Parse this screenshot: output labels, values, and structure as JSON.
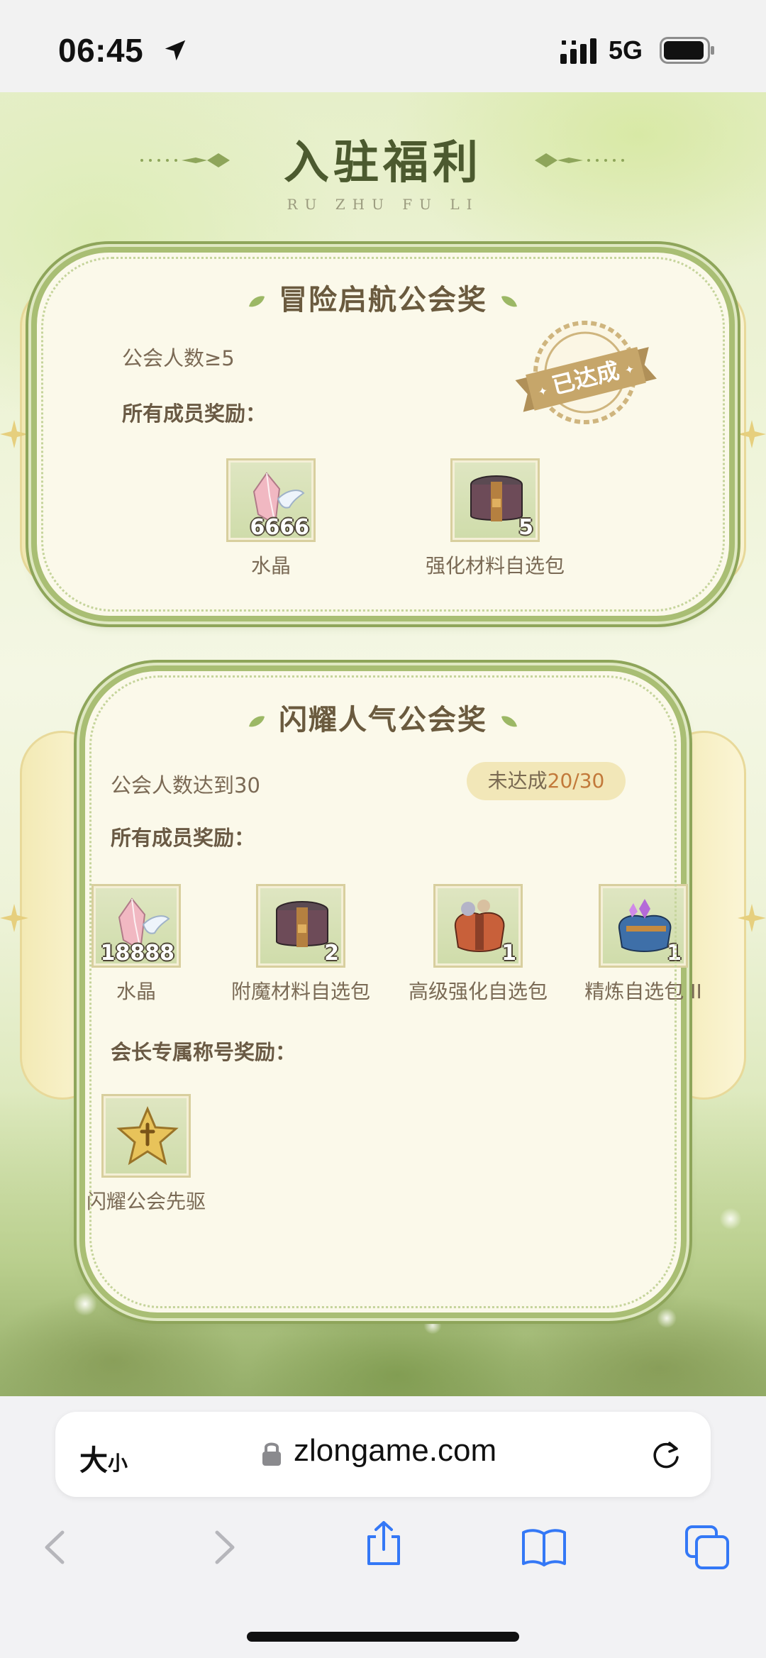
{
  "status_bar": {
    "time": "06:45",
    "network": "5G",
    "icons": [
      "location-arrow-icon",
      "signal-bars-icon",
      "battery-icon"
    ]
  },
  "page": {
    "title": "入驻福利",
    "subtitle": "RU ZHU FU LI"
  },
  "card1": {
    "title": "冒险启航公会奖",
    "condition": "公会人数≥5",
    "status": "已达成",
    "rewards_label": "所有成员奖励：",
    "rewards": [
      {
        "name": "水晶",
        "count": "6666",
        "icon": "crystal-icon"
      },
      {
        "name": "强化材料自选包",
        "count": "5",
        "icon": "material-chest-icon"
      }
    ]
  },
  "card2": {
    "title": "闪耀人气公会奖",
    "condition": "公会人数达到30",
    "status": {
      "label": "未达成",
      "progress": "20/30"
    },
    "rewards_label": "所有成员奖励：",
    "rewards": [
      {
        "name": "水晶",
        "count": "18888",
        "icon": "crystal-icon"
      },
      {
        "name": "附魔材料自选包",
        "count": "2",
        "icon": "enchant-chest-icon"
      },
      {
        "name": "高级强化自选包",
        "count": "1",
        "icon": "advanced-bag-icon"
      },
      {
        "name": "精炼自选包 II",
        "count": "1",
        "icon": "refine-bag-icon"
      }
    ],
    "leader_label": "会长专属称号奖励：",
    "leader_rewards": [
      {
        "name": "闪耀公会先驱",
        "icon": "star-title-icon"
      }
    ]
  },
  "browser": {
    "text_size_big": "大",
    "text_size_small": "小",
    "url": "zlongame.com",
    "toolbar": [
      "back-icon",
      "forward-icon",
      "share-icon",
      "bookmarks-icon",
      "tabs-icon"
    ]
  },
  "colors": {
    "accent_green": "#a9be74",
    "card_bg": "#fbf9ea",
    "title": "#4c5a2f",
    "progress": "#c2793a",
    "ios_blue": "#3478f6"
  }
}
